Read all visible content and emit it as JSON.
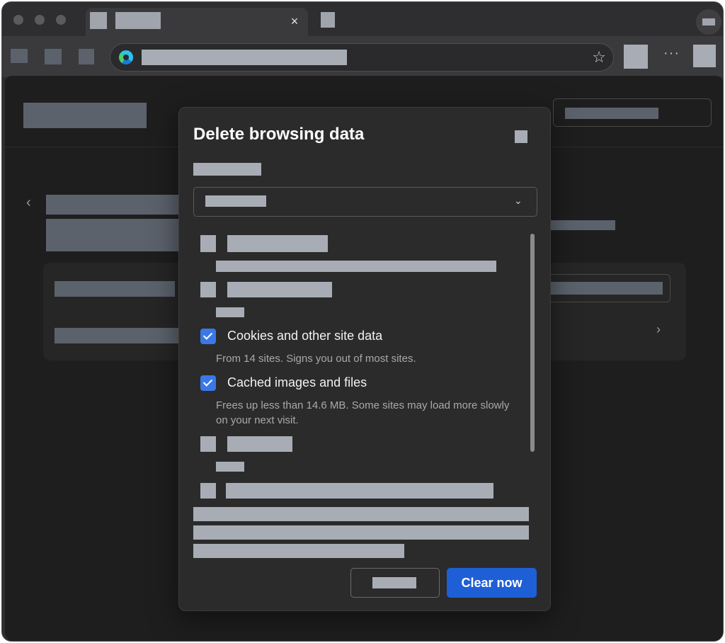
{
  "window": {
    "tab_close_glyph": "×",
    "more_glyph": "···",
    "star_glyph": "☆"
  },
  "dialog": {
    "title": "Delete browsing data",
    "items": [
      {
        "label": "Cookies and other site data",
        "description": "From 14 sites. Signs you out of most sites.",
        "checked": true
      },
      {
        "label": "Cached images and files",
        "description": "Frees up less than 14.6 MB. Some sites may load more slowly on your next visit.",
        "checked": true
      }
    ],
    "clear_button": "Clear now"
  },
  "colors": {
    "accent": "#1f5fd6",
    "checkbox": "#3b78e7",
    "dialog_bg": "#2b2b2b"
  }
}
